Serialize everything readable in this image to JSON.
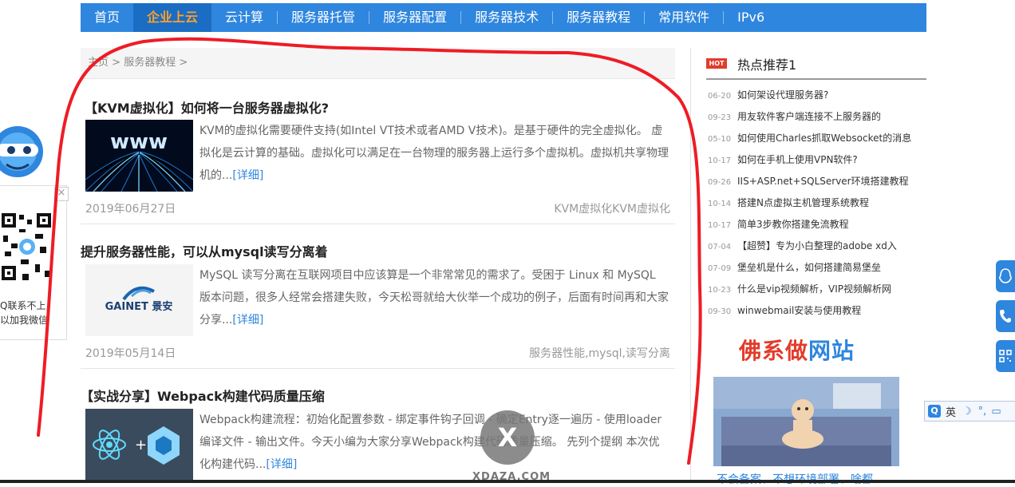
{
  "nav": {
    "items": [
      {
        "label": "首页",
        "active": false
      },
      {
        "label": "企业上云",
        "active": true
      },
      {
        "label": "云计算",
        "active": false
      },
      {
        "label": "服务器托管",
        "active": false
      },
      {
        "label": "服务器配置",
        "active": false
      },
      {
        "label": "服务器技术",
        "active": false
      },
      {
        "label": "服务器教程",
        "active": false
      },
      {
        "label": "常用软件",
        "active": false
      },
      {
        "label": "IPv6",
        "active": false
      }
    ],
    "bg_color": "#2e86de",
    "active_color": "#ff9f2e"
  },
  "breadcrumb": {
    "home": "主页",
    "sep": ">",
    "category": "服务器教程"
  },
  "articles": [
    {
      "title": "【KVM虚拟化】如何将一台服务器虚拟化?",
      "excerpt": "KVM的虚拟化需要硬件支持(如Intel VT技术或者AMD V技术)。是基于硬件的完全虚拟化。 虚拟化是云计算的基础。虚拟化可以满足在一台物理的服务器上运行多个虚拟机。虚拟机共享物理机的...",
      "more": "[详细]",
      "date": "2019年06月27日",
      "tags": "KVM虚拟化KVM虚拟化",
      "thumb": "blue-fiber-www-image"
    },
    {
      "title": "提升服务器性能，可以从mysql读写分离着",
      "excerpt": "MySQL 读写分离在互联网项目中应该算是一个非常常见的需求了。受困于 Linux 和 MySQL 版本问题，很多人经常会搭建失败，今天松哥就给大伙举一个成功的例子，后面有时间再和大家分享...",
      "more": "[详细]",
      "date": "2019年05月14日",
      "tags": "服务器性能,mysql,读写分离",
      "thumb_text": "GAINET 景安"
    },
    {
      "title": "【实战分享】Webpack构建代码质量压缩",
      "excerpt": "Webpack构建流程：初始化配置参数 - 绑定事件钩子回调 - 确定Entry逐一遍历 - 使用loader编译文件 - 输出文件。今天小编为大家分享Webpack构建代码质量压缩。 先列个提纲 本次优化构建代码...",
      "more": "[详细]",
      "thumb": "react-plus-webpack-image"
    }
  ],
  "sidebar": {
    "hot_badge": "HOT",
    "hot_title": "热点推荐1",
    "hot_items": [
      {
        "date": "06-20",
        "title": "如何架设代理服务器?"
      },
      {
        "date": "09-23",
        "title": "用友软件客户端连接不上服务器的"
      },
      {
        "date": "05-10",
        "title": "如何使用Charles抓取Websocket的消息"
      },
      {
        "date": "10-17",
        "title": "如何在手机上使用VPN软件?"
      },
      {
        "date": "09-26",
        "title": "IIS+ASP.net+SQLServer环境搭建教程"
      },
      {
        "date": "10-14",
        "title": "搭建N点虚拟主机管理系统教程"
      },
      {
        "date": "10-17",
        "title": "简单3步教你搭建免流教程"
      },
      {
        "date": "07-04",
        "title": "【超赞】专为小白整理的adobe xd入"
      },
      {
        "date": "07-09",
        "title": "堡垒机是什么，如何搭建简易堡垒"
      },
      {
        "date": "10-23",
        "title": "什么是vip视频解析，VIP视频解析网"
      },
      {
        "date": "09-30",
        "title": "winwebmail安装与使用教程"
      }
    ],
    "promo_title_part1": "佛系做",
    "promo_title_part2": "网站",
    "promo_caption": "不会备案、不想环境部署、啥都"
  },
  "float_widget": {
    "line1": "Q联系不上,",
    "line2": "以加我微信",
    "close": "×"
  },
  "ime": {
    "q": "Q",
    "label": "英"
  },
  "overlay": {
    "close": "X",
    "watermark": "XDAZA.COM"
  }
}
